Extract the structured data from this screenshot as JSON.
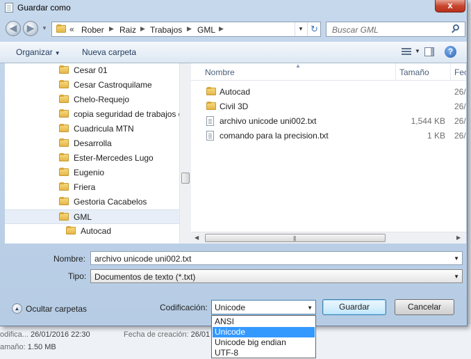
{
  "background": {
    "line1_label": "odifica...",
    "line1_value": "26/01/2016 22:30",
    "line2_label": "amaño:",
    "line2_value": "1.50 MB",
    "line3_label": "Fecha de creación:",
    "line3_value": "26/01"
  },
  "window": {
    "title": "Guardar como",
    "close_label": "x"
  },
  "nav": {
    "crumb_chevron": "«",
    "breadcrumbs": [
      "Rober",
      "Raiz",
      "Trabajos",
      "GML"
    ],
    "search_placeholder": "Buscar GML"
  },
  "toolbar": {
    "organize_label": "Organizar",
    "new_folder_label": "Nueva carpeta"
  },
  "tree": {
    "items": [
      {
        "label": "Cesar 01"
      },
      {
        "label": "Cesar Castroquilame"
      },
      {
        "label": "Chelo-Requejo"
      },
      {
        "label": "copia seguridad de trabajos d"
      },
      {
        "label": "Cuadricula MTN"
      },
      {
        "label": "Desarrolla"
      },
      {
        "label": "Ester-Mercedes Lugo"
      },
      {
        "label": "Eugenio"
      },
      {
        "label": "Friera"
      },
      {
        "label": "Gestoria Cacabelos"
      },
      {
        "label": "GML"
      },
      {
        "label": "Autocad"
      }
    ]
  },
  "list": {
    "columns": {
      "name": "Nombre",
      "size": "Tamaño",
      "date": "Fec"
    },
    "rows": [
      {
        "name": "Autocad",
        "size": "",
        "date": "26/",
        "type": "folder"
      },
      {
        "name": "Civil 3D",
        "size": "",
        "date": "26/",
        "type": "folder"
      },
      {
        "name": "archivo unicode uni002.txt",
        "size": "1,544 KB",
        "date": "26/",
        "type": "file"
      },
      {
        "name": "comando para la precision.txt",
        "size": "1 KB",
        "date": "26/",
        "type": "file"
      }
    ]
  },
  "form": {
    "name_label": "Nombre:",
    "name_value": "archivo unicode uni002.txt",
    "type_label": "Tipo:",
    "type_value": "Documentos de texto (*.txt)"
  },
  "footer": {
    "hide_folders_label": "Ocultar carpetas",
    "encoding_label": "Codificación:",
    "encoding_value": "Unicode",
    "save_label": "Guardar",
    "cancel_label": "Cancelar",
    "encoding_options": [
      "ANSI",
      "Unicode",
      "Unicode big endian",
      "UTF-8"
    ]
  },
  "colors": {
    "selection": "#3399ff",
    "title_gradient": "#c6d8ec",
    "close_red": "#c7472f"
  }
}
